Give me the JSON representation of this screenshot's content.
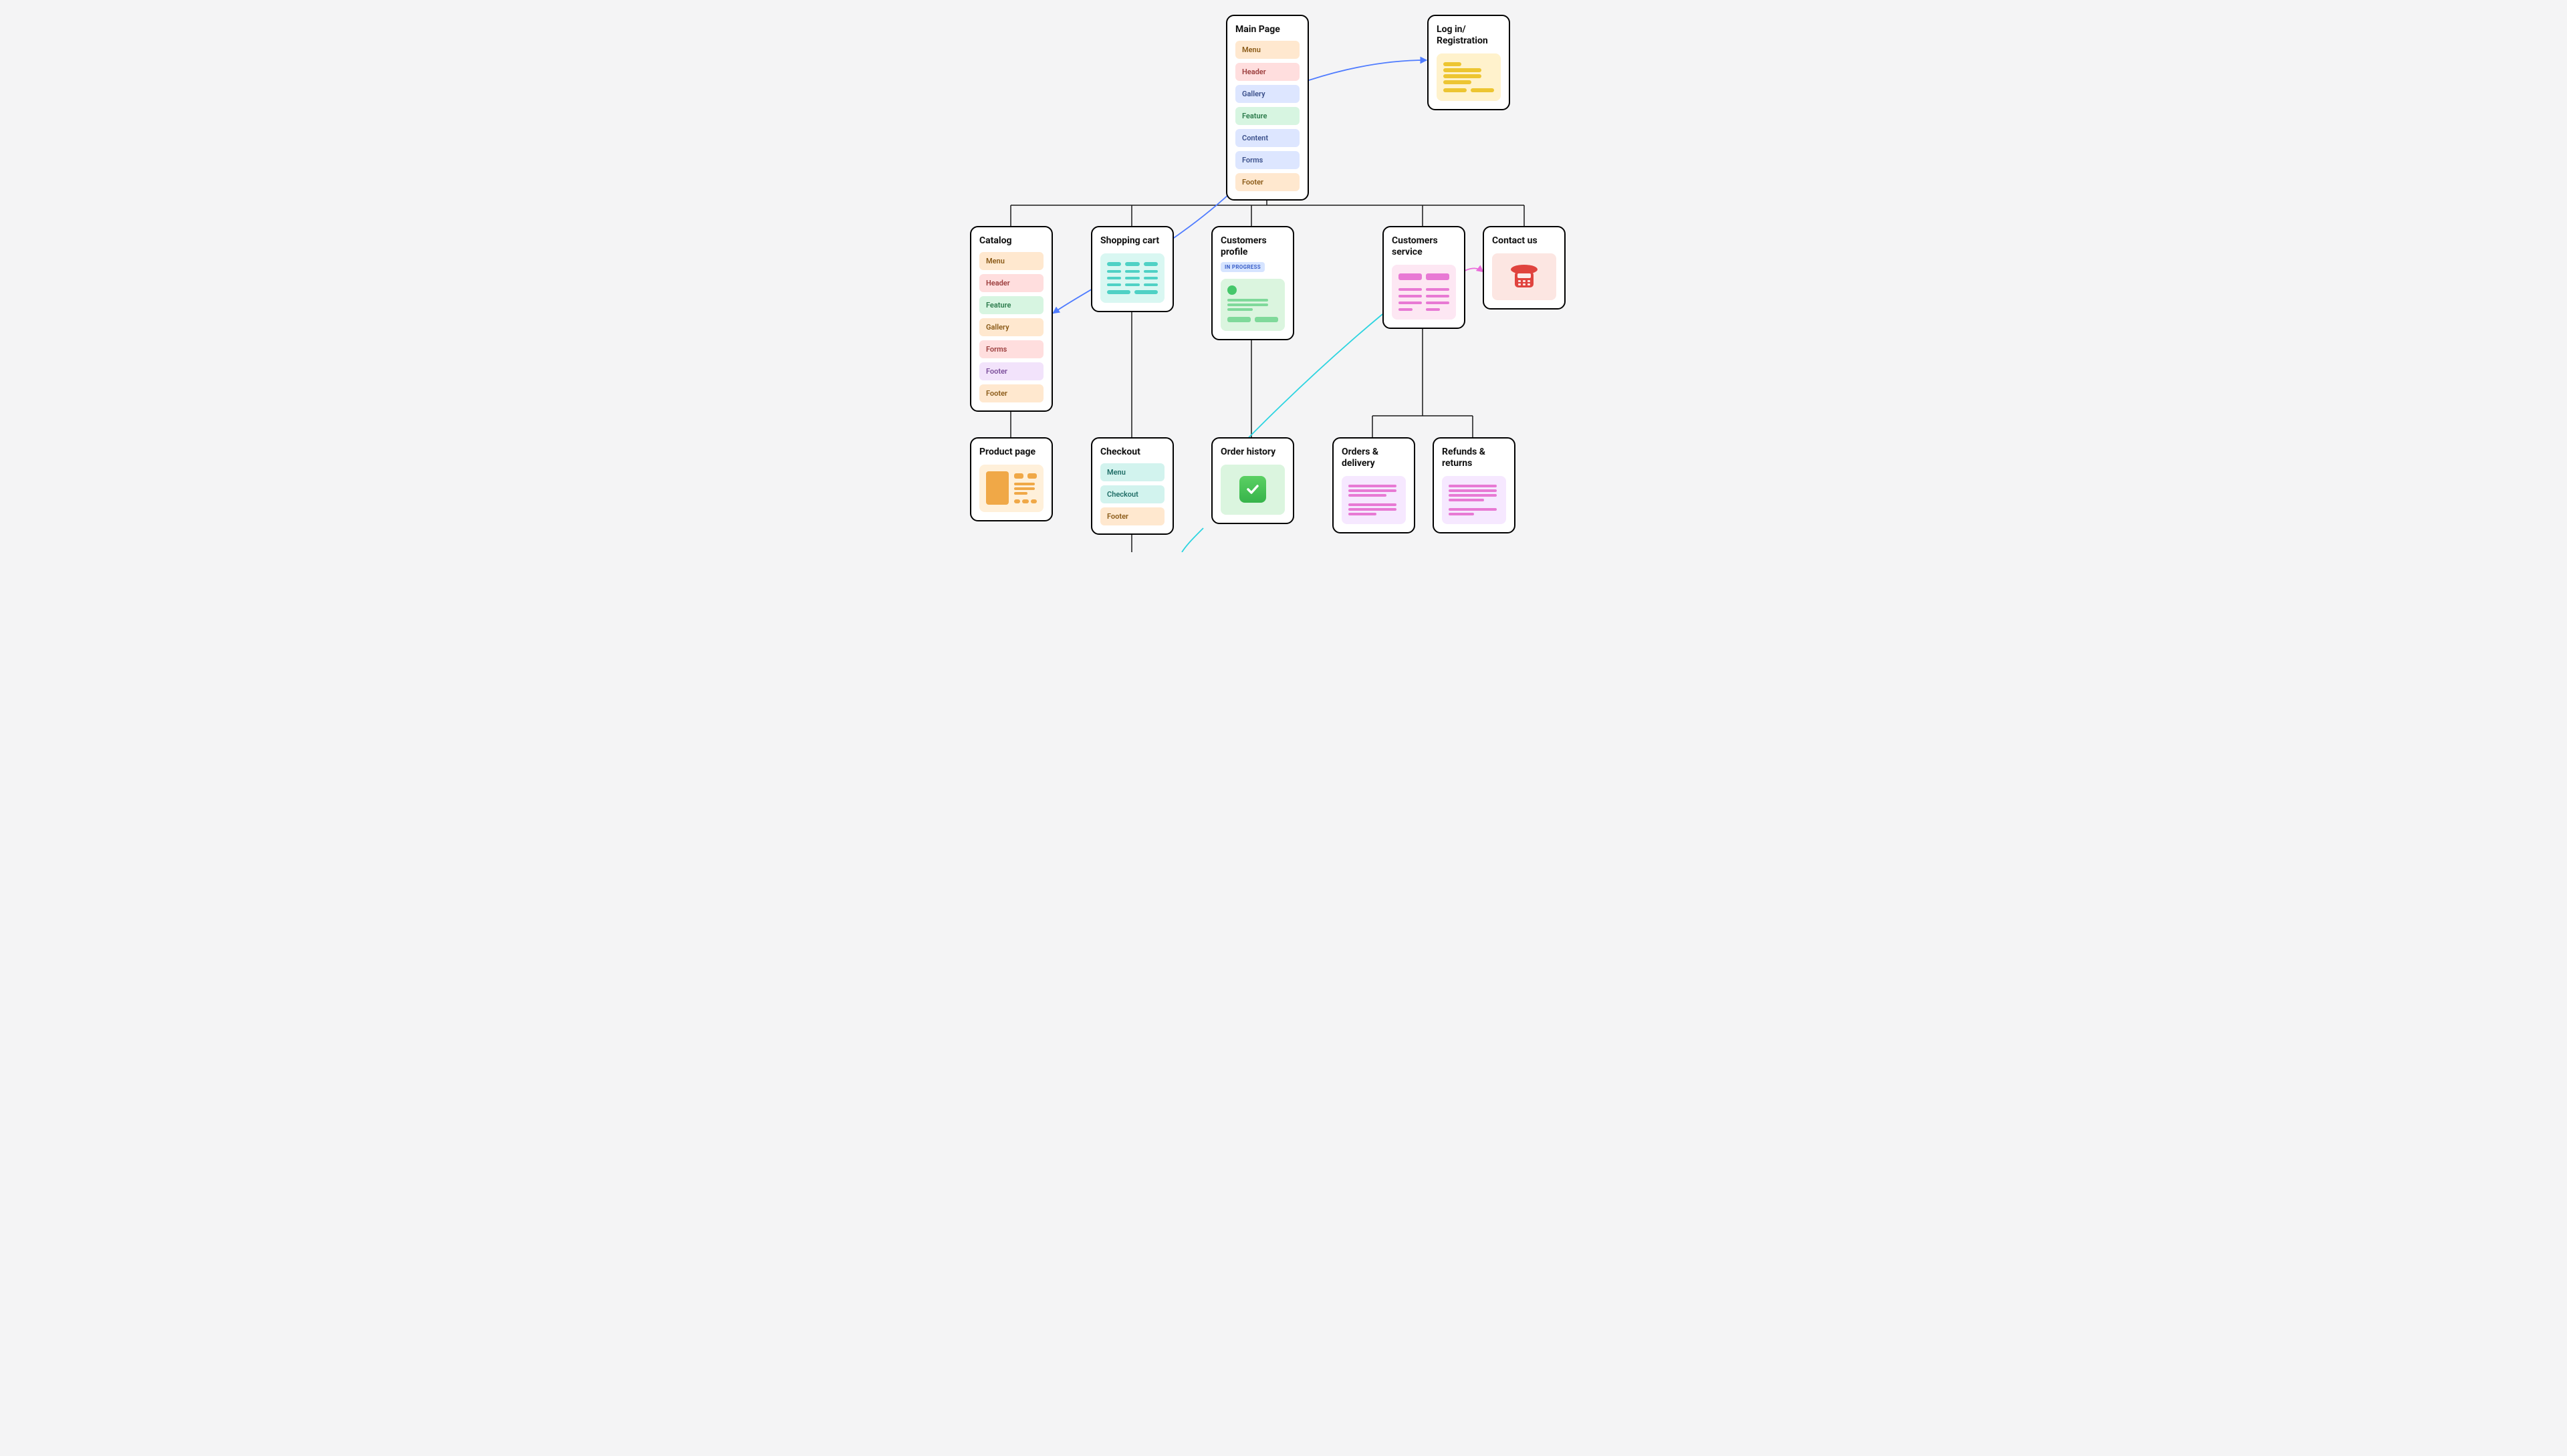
{
  "nodes": {
    "main_page": {
      "title": "Main Page",
      "sections": [
        {
          "label": "Menu",
          "color": "c-peach"
        },
        {
          "label": "Header",
          "color": "c-pink"
        },
        {
          "label": "Gallery",
          "color": "c-blue"
        },
        {
          "label": "Feature",
          "color": "c-mint"
        },
        {
          "label": "Content",
          "color": "c-blue"
        },
        {
          "label": "Forms",
          "color": "c-blue"
        },
        {
          "label": "Footer",
          "color": "c-peach"
        }
      ]
    },
    "login": {
      "title": "Log in/ Registration"
    },
    "catalog": {
      "title": "Catalog",
      "sections": [
        {
          "label": "Menu",
          "color": "c-peach"
        },
        {
          "label": "Header",
          "color": "c-pink"
        },
        {
          "label": "Feature",
          "color": "c-mint"
        },
        {
          "label": "Gallery",
          "color": "c-peach"
        },
        {
          "label": "Forms",
          "color": "c-pink"
        },
        {
          "label": "Footer",
          "color": "c-lilac"
        },
        {
          "label": "Footer",
          "color": "c-peach"
        }
      ]
    },
    "cart": {
      "title": "Shopping cart"
    },
    "profile": {
      "title": "Customers profile",
      "badge": "IN PROGRESS"
    },
    "service": {
      "title": "Customers service"
    },
    "contact": {
      "title": "Contact us"
    },
    "product": {
      "title": "Product page"
    },
    "checkout": {
      "title": "Checkout",
      "sections": [
        {
          "label": "Menu",
          "color": "c-teal"
        },
        {
          "label": "Checkout",
          "color": "c-teal"
        },
        {
          "label": "Footer",
          "color": "c-peach"
        }
      ]
    },
    "order_history": {
      "title": "Order history"
    },
    "orders_delivery": {
      "title": "Orders & delivery"
    },
    "refunds": {
      "title": "Refunds & returns"
    }
  },
  "colors": {
    "bg": "#f4f4f5",
    "node_border": "#000000",
    "connector": "#1a1a1a",
    "arrow_blue": "#4f7cff",
    "arrow_cyan": "#2dd4e0",
    "arrow_pink": "#e96bd9",
    "yellow": "#edc531",
    "teal": "#4fd1c5",
    "green": "#45c76a",
    "magenta": "#e879d4",
    "orange": "#f0a847",
    "red": "#e0433e"
  }
}
